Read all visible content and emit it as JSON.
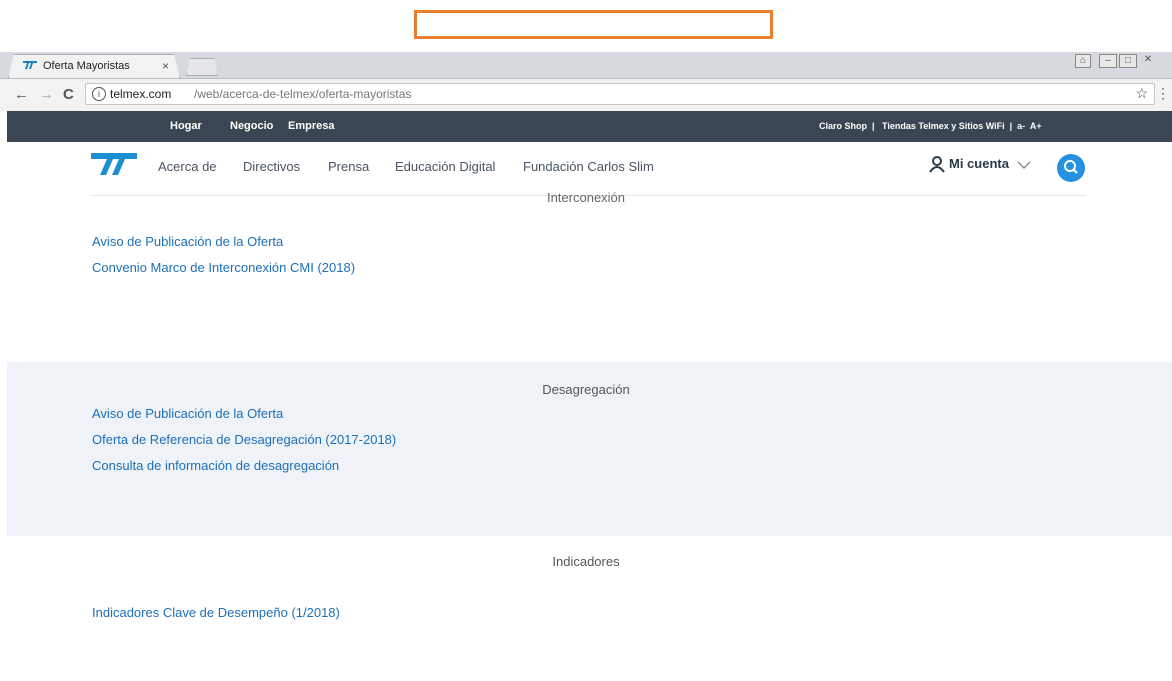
{
  "browser": {
    "tab_title": "Oferta Mayoristas",
    "tab_close": "×",
    "url_host": "telmex.com",
    "url_path": "/web/acerca-de-telmex/oferta-mayoristas",
    "info_icon": "i",
    "back": "←",
    "forward": "→",
    "reload": "C",
    "star": "☆",
    "menu": "⋮"
  },
  "topbar": {
    "left_links": [
      "Hogar",
      "Negocio",
      "Empresa"
    ],
    "right_text": "Claro Shop  |   Tiendas Telmex y Sitios WiFi  |  a-  A+"
  },
  "nav": {
    "links": [
      "Acerca de",
      "Directivos",
      "Prensa",
      "Educación Digital",
      "Fundación Carlos Slim"
    ],
    "account": "Mi cuenta"
  },
  "sections": {
    "interconexion": {
      "title": "Interconexión",
      "links": [
        "Aviso de Publicación de la Oferta",
        "Convenio Marco de Interconexión CMI (2018)"
      ]
    },
    "desagregacion": {
      "title": "Desagregación",
      "links": [
        "Aviso de Publicación de la Oferta",
        "Oferta de Referencia de Desagregación (2017-2018)",
        "Consulta de información de desagregación"
      ]
    },
    "indicadores": {
      "title": "Indicadores",
      "links": [
        "Indicadores Clave de Desempeño (1/2018)"
      ]
    }
  },
  "colors": {
    "accent": "#2591e0",
    "topbar": "#3a4652",
    "link": "#1d6fb8",
    "highlight": "#e87e2f"
  }
}
